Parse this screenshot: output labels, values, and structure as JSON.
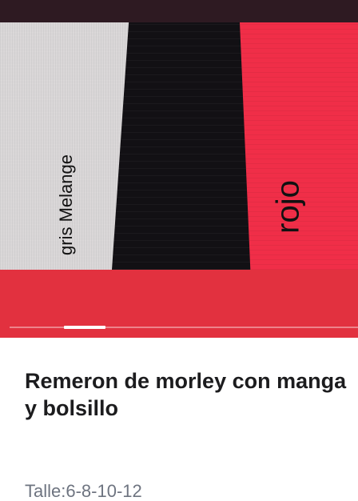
{
  "gallery": {
    "labels": {
      "gray": "gris Melange",
      "red": "rojo"
    },
    "slide_position": "2"
  },
  "product": {
    "title": "Remeron de morley con manga\ny bolsillo",
    "sizes": "Talle:6-8-10-12"
  },
  "colors": {
    "gallery_background": "#e2313f",
    "top_bar": "#2e1a22",
    "title_text": "#1c1c1e",
    "sizes_text": "#6e7480"
  }
}
